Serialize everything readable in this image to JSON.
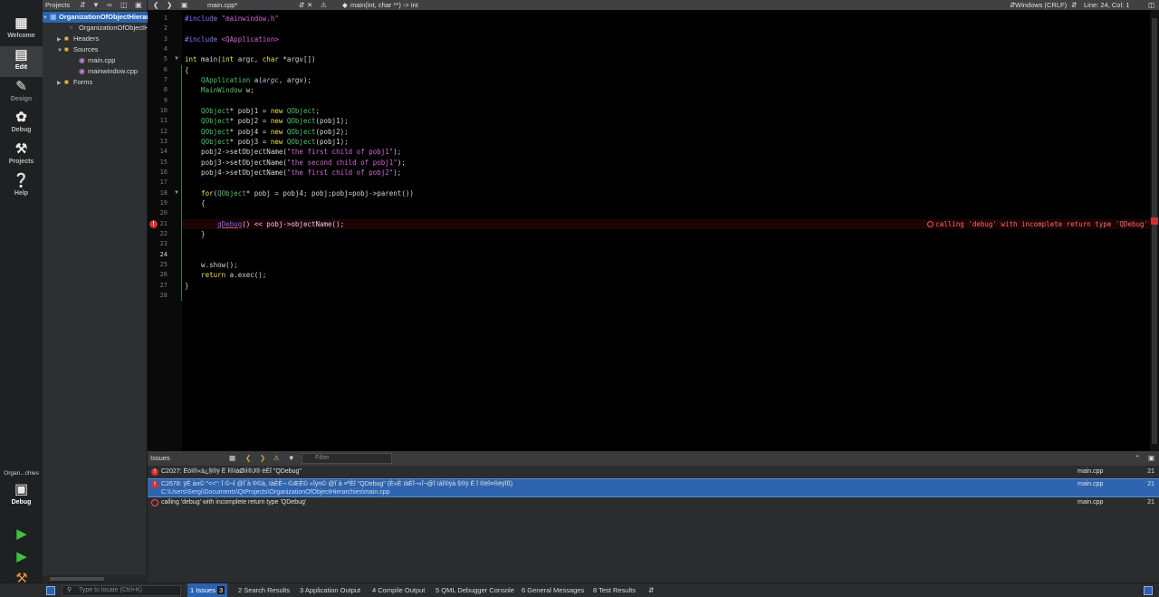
{
  "modes": [
    {
      "label": "Welcome",
      "icon": "grid-icon"
    },
    {
      "label": "Edit",
      "icon": "edit-icon"
    },
    {
      "label": "Design",
      "icon": "pen-icon"
    },
    {
      "label": "Debug",
      "icon": "bug-icon"
    },
    {
      "label": "Projects",
      "icon": "wrench-icon"
    },
    {
      "label": "Help",
      "icon": "help-icon"
    }
  ],
  "kit": {
    "name": "Organ...chies",
    "label": "Debug"
  },
  "projects": {
    "header": "Projects",
    "tree": [
      {
        "label": "OrganizationOfObjectHierarchies",
        "depth": 0
      },
      {
        "label": "OrganizationOfObjectHierarchies.pro",
        "depth": 1
      },
      {
        "label": "Headers",
        "depth": 1
      },
      {
        "label": "Sources",
        "depth": 1
      },
      {
        "label": "main.cpp",
        "depth": 2
      },
      {
        "label": "mainwindow.cpp",
        "depth": 2
      },
      {
        "label": "Forms",
        "depth": 1
      }
    ]
  },
  "editor_toolbar": {
    "file": "main.cpp*",
    "symbol": "main(int, char **) -> int",
    "line_endings": "Windows (CRLF)",
    "position": "Line: 24, Col: 1"
  },
  "code": {
    "line_numbers": [
      "1",
      "2",
      "3",
      "4",
      "5",
      "6",
      "7",
      "8",
      "9",
      "10",
      "11",
      "12",
      "13",
      "14",
      "15",
      "16",
      "17",
      "18",
      "19",
      "20",
      "21",
      "22",
      "23",
      "24",
      "25",
      "26",
      "27",
      "28"
    ],
    "l1_a": "#include ",
    "l1_b": "\"mainwindow.h\"",
    "l3_a": "#include ",
    "l3_b": "<QApplication>",
    "l5_a": "int",
    "l5_b": " main(",
    "l5_c": "int",
    "l5_d": " argc, ",
    "l5_e": "char",
    "l5_f": " *argv[])",
    "l6": "{",
    "l7_a": "    QApplication",
    "l7_b": " a(",
    "l7_c": "argc",
    "l7_d": ", argv);",
    "l8_a": "    MainWindow",
    "l8_b": " w;",
    "l10_a": "    QObject",
    "l10_b": "* pobj1 = ",
    "l10_c": "new",
    "l10_d": " QObject",
    "l10_e": ";",
    "l11_a": "    QObject",
    "l11_b": "* pobj2 = ",
    "l11_c": "new",
    "l11_d": " QObject",
    "l11_e": "(pobj1);",
    "l12_a": "    QObject",
    "l12_b": "* pobj4 = ",
    "l12_c": "new",
    "l12_d": " QObject",
    "l12_e": "(pobj2);",
    "l13_a": "    QObject",
    "l13_b": "* pobj3 = ",
    "l13_c": "new",
    "l13_d": " QObject",
    "l13_e": "(pobj1);",
    "l14_a": "    pobj2->setObjectName(",
    "l14_b": "\"the first child of pobj1\"",
    "l14_c": ");",
    "l15_a": "    pobj3->setObjectName(",
    "l15_b": "\"the second child of pobj1\"",
    "l15_c": ");",
    "l16_a": "    pobj4->setObjectName(",
    "l16_b": "\"the first child of pobj2\"",
    "l16_c": ");",
    "l18_a": "    for",
    "l18_b": "(",
    "l18_c": "QObject",
    "l18_d": "* pobj = pobj4; pobj;pobj=pobj->parent())",
    "l19": "    {",
    "l21_a": "        ",
    "l21_b": "qDebug",
    "l21_c": "() << pobj->objectName();",
    "l22": "    }",
    "l25": "    w.show();",
    "l26_a": "    return",
    "l26_b": " a.exec();",
    "l27": "}",
    "inline_error": "calling 'debug' with incomplete return type 'QDebug'"
  },
  "issues": {
    "title": "Issues",
    "filter_placeholder": "Filter",
    "rows": [
      {
        "text": "C2027: Ëóï®«à¿§®ÿ Ë­ Ï®ìàØíí®J® èÉÏ  \"QDebug\"",
        "path": "",
        "file": "main.cpp",
        "line": "21"
      },
      {
        "text": "C2678: ÿÈ àn© \"<<\": Ï ©¬Ï @Ï´à ®©à, ïàÈÈ¬ ©ÆÈ© «Ïÿn© @Ï´à ×ªÈÏ  \"QDebug\" (È«È ïàÈÏ¬«Ï¬@Ï ïàÏ®ÿà §®ÿ Ë­ Ï ®ëÏ¤®ëÿÏ­ß)",
        "path": "C:\\Users\\Sergi\\Documents\\QtProjects\\OrganizationOfObjectHierarchies\\main.cpp",
        "file": "main.cpp",
        "line": "21"
      },
      {
        "text": "calling 'debug' with incomplete return type 'QDebug'",
        "path": "",
        "file": "main.cpp",
        "line": "21"
      }
    ]
  },
  "statusbar": {
    "locate_placeholder": "Type to locate (Ctrl+K)",
    "tabs": [
      {
        "num": "1",
        "label": "Issues",
        "count": "3"
      },
      {
        "num": "2",
        "label": "Search Results"
      },
      {
        "num": "3",
        "label": "Application Output"
      },
      {
        "num": "4",
        "label": "Compile Output"
      },
      {
        "num": "5",
        "label": "QML Debugger Console"
      },
      {
        "num": "6",
        "label": "General Messages"
      },
      {
        "num": "8",
        "label": "Test Results"
      }
    ]
  }
}
